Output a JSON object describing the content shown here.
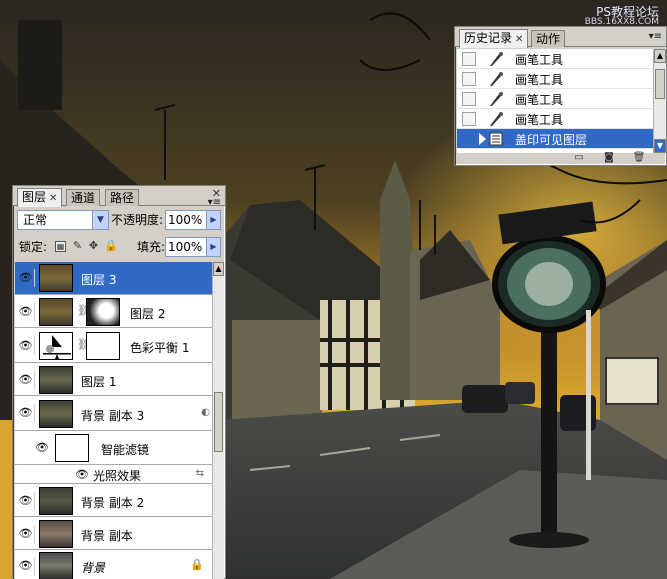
{
  "watermark": {
    "line1": "PS教程论坛",
    "line2": "BBS.16XX8.COM"
  },
  "history_panel": {
    "tabs": [
      {
        "label": "历史记录",
        "active": true,
        "closable": true
      },
      {
        "label": "动作",
        "active": false,
        "closable": false
      }
    ],
    "items": [
      {
        "label": "画笔工具",
        "icon": "brush-icon",
        "selected": false
      },
      {
        "label": "画笔工具",
        "icon": "brush-icon",
        "selected": false
      },
      {
        "label": "画笔工具",
        "icon": "brush-icon",
        "selected": false
      },
      {
        "label": "画笔工具",
        "icon": "brush-icon",
        "selected": false
      },
      {
        "label": "盖印可见图层",
        "icon": "layer-stack-icon",
        "selected": true
      }
    ],
    "footer_icons": [
      "new-document-from-state-icon",
      "new-snapshot-icon",
      "trash-icon"
    ]
  },
  "layers_panel": {
    "tabs": [
      {
        "label": "图层",
        "active": true,
        "closable": true
      },
      {
        "label": "通道",
        "active": false,
        "closable": false
      },
      {
        "label": "路径",
        "active": false,
        "closable": false
      }
    ],
    "blend_mode": "正常",
    "opacity_label": "不透明度:",
    "opacity_value": "100%",
    "lock_label": "锁定:",
    "fill_label": "填充:",
    "fill_value": "100%",
    "layers": [
      {
        "name": "图层 3",
        "selected": true,
        "visible": true,
        "kind": "pixel"
      },
      {
        "name": "图层 2",
        "selected": false,
        "visible": true,
        "kind": "masked"
      },
      {
        "name": "色彩平衡 1",
        "selected": false,
        "visible": true,
        "kind": "adjustment"
      },
      {
        "name": "图层 1",
        "selected": false,
        "visible": true,
        "kind": "pixel"
      },
      {
        "name": "背景 副本 3",
        "selected": false,
        "visible": true,
        "kind": "smart-object"
      },
      {
        "name": "智能滤镜",
        "selected": false,
        "visible": true,
        "kind": "smart-filter"
      },
      {
        "name": "光照效果",
        "selected": false,
        "visible": true,
        "kind": "filter-effect"
      },
      {
        "name": "背景 副本 2",
        "selected": false,
        "visible": true,
        "kind": "pixel"
      },
      {
        "name": "背景 副本",
        "selected": false,
        "visible": true,
        "kind": "pixel"
      },
      {
        "name": "背景",
        "selected": false,
        "visible": true,
        "kind": "locked"
      }
    ]
  },
  "colors": {
    "selection": "#316ac5",
    "panel_bg": "#d4d0c8",
    "sky_top": "#2e2a24",
    "sky_glow": "#d9a12a"
  }
}
